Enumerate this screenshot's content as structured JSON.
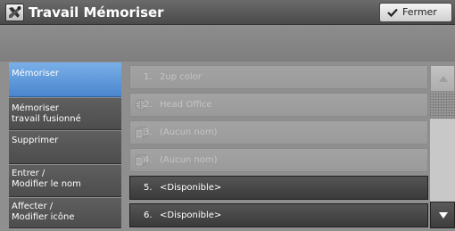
{
  "window": {
    "title": "Travail Mémoriser",
    "close_label": "Fermer"
  },
  "nav": [
    {
      "label1": "Mémoriser",
      "label2": "",
      "selected": true
    },
    {
      "label1": "Mémoriser",
      "label2": "travail fusionné",
      "selected": false
    },
    {
      "label1": "Supprimer",
      "label2": "",
      "selected": false
    },
    {
      "label1": "Entrer /",
      "label2": "Modifier le nom",
      "selected": false
    },
    {
      "label1": "Affecter /",
      "label2": "Modifier icône",
      "selected": false
    }
  ],
  "list": [
    {
      "num": "1.",
      "name": "2up color",
      "icon": "",
      "enabled": false
    },
    {
      "num": "2.",
      "name": "Head Office",
      "icon": "globe-icon",
      "enabled": false
    },
    {
      "num": "3.",
      "name": "(Aucun nom)",
      "icon": "document-stack-icon",
      "enabled": false
    },
    {
      "num": "4.",
      "name": "(Aucun nom)",
      "icon": "document-stack-icon",
      "enabled": false
    },
    {
      "num": "5.",
      "name": "<Disponible>",
      "icon": "",
      "enabled": true
    },
    {
      "num": "6.",
      "name": "<Disponible>",
      "icon": "",
      "enabled": true
    }
  ],
  "colors": {
    "accent": "#4a86cf",
    "title_bar": "#4a4a4a"
  }
}
